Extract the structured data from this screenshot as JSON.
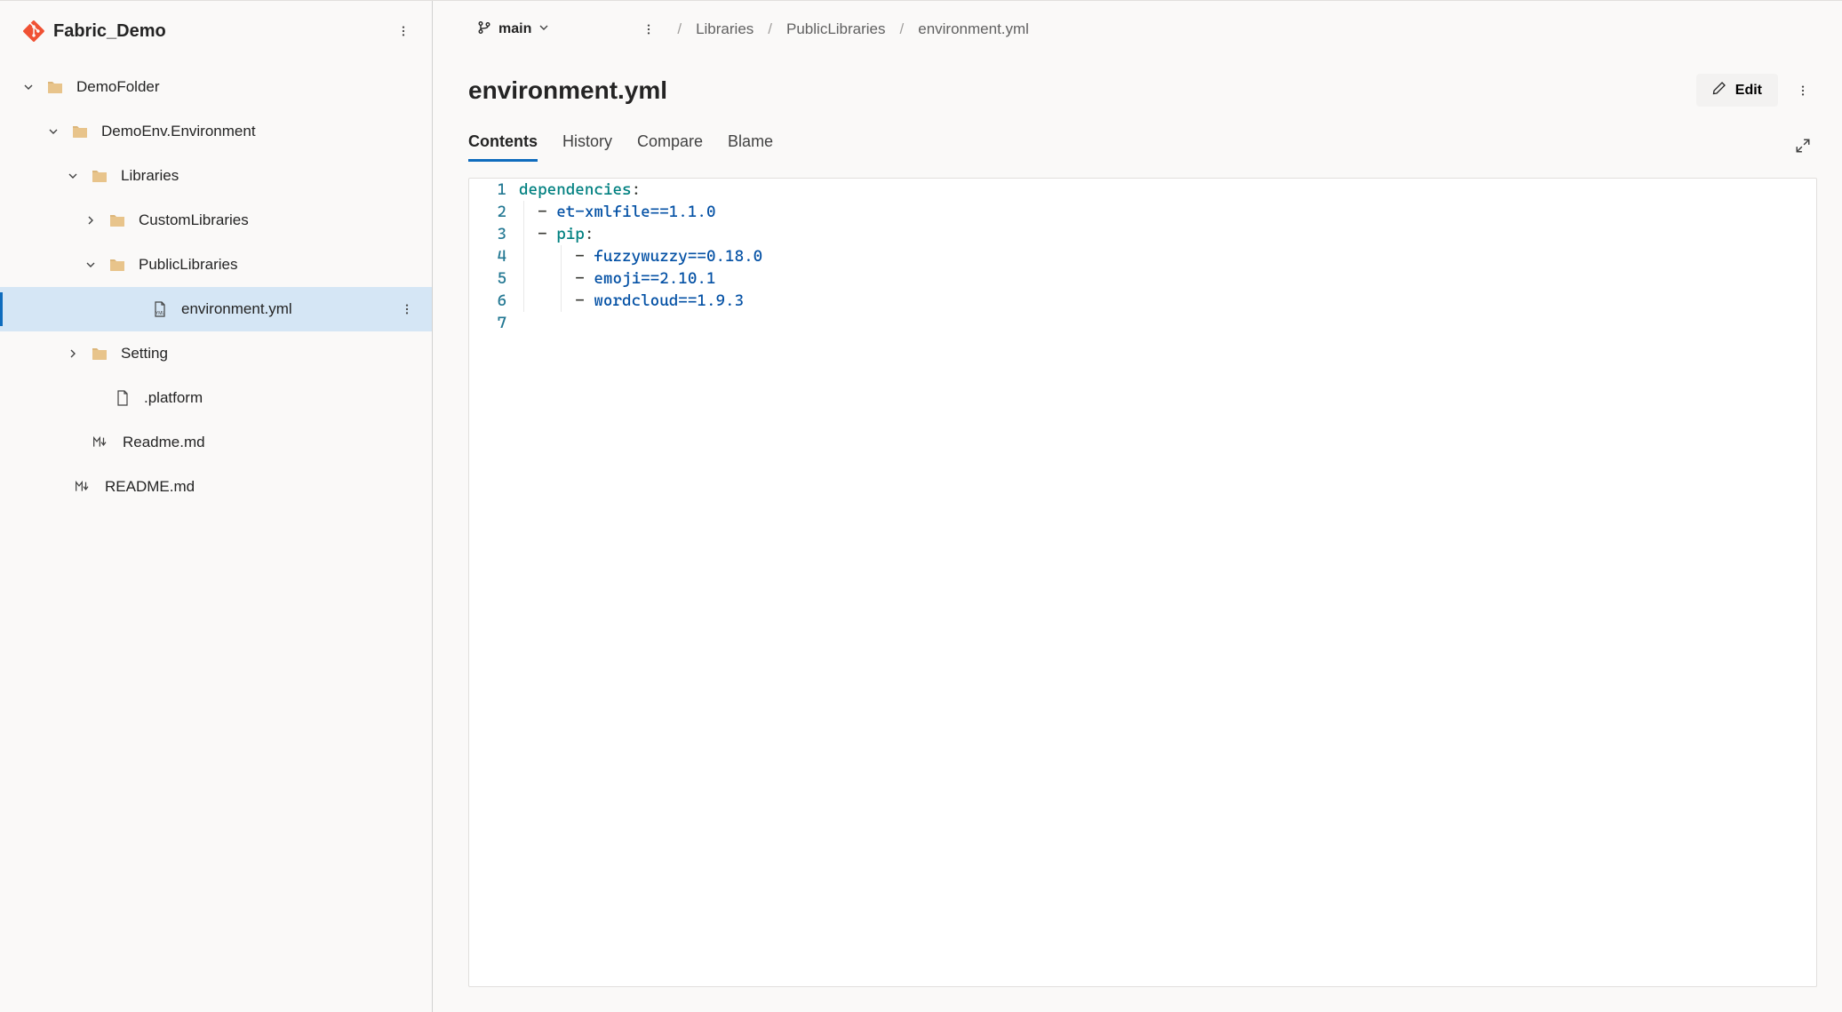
{
  "repo": {
    "name": "Fabric_Demo"
  },
  "tree": {
    "items": [
      {
        "indent": 24,
        "chevron": "down",
        "icon": "folder",
        "label": "DemoFolder"
      },
      {
        "indent": 52,
        "chevron": "down",
        "icon": "folder",
        "label": "DemoEnv.Environment"
      },
      {
        "indent": 74,
        "chevron": "down",
        "icon": "folder",
        "label": "Libraries"
      },
      {
        "indent": 94,
        "chevron": "right",
        "icon": "folder",
        "label": "CustomLibraries"
      },
      {
        "indent": 94,
        "chevron": "down",
        "icon": "folder",
        "label": "PublicLibraries"
      },
      {
        "indent": 142,
        "chevron": "none",
        "icon": "yml",
        "label": "environment.yml",
        "selected": true,
        "more": true
      },
      {
        "indent": 74,
        "chevron": "right",
        "icon": "folder",
        "label": "Setting"
      },
      {
        "indent": 100,
        "chevron": "none",
        "icon": "file",
        "label": ".platform"
      },
      {
        "indent": 76,
        "chevron": "none",
        "icon": "md",
        "label": "Readme.md"
      },
      {
        "indent": 56,
        "chevron": "none",
        "icon": "md",
        "label": "README.md"
      }
    ]
  },
  "branch": {
    "name": "main"
  },
  "breadcrumb": {
    "items": [
      {
        "label": "Libraries"
      },
      {
        "label": "PublicLibraries"
      },
      {
        "label": "environment.yml"
      }
    ]
  },
  "file": {
    "title": "environment.yml"
  },
  "buttons": {
    "edit": "Edit"
  },
  "tabs": {
    "items": [
      {
        "label": "Contents",
        "active": true
      },
      {
        "label": "History"
      },
      {
        "label": "Compare"
      },
      {
        "label": "Blame"
      }
    ]
  },
  "code": {
    "lines": [
      {
        "n": 1,
        "html": "<span class='tok-key'>dependencies</span><span class='tok-punct'>:</span>"
      },
      {
        "n": 2,
        "html": "  <span class='tok-punct'>-</span> <span class='tok-str'>et-xmlfile==1.1.0</span>"
      },
      {
        "n": 3,
        "html": "  <span class='tok-punct'>-</span> <span class='tok-key'>pip</span><span class='tok-punct'>:</span>"
      },
      {
        "n": 4,
        "html": "      <span class='tok-punct'>-</span> <span class='tok-str'>fuzzywuzzy==0.18.0</span>"
      },
      {
        "n": 5,
        "html": "      <span class='tok-punct'>-</span> <span class='tok-str'>emoji==2.10.1</span>"
      },
      {
        "n": 6,
        "html": "      <span class='tok-punct'>-</span> <span class='tok-str'>wordcloud==1.9.3</span>"
      },
      {
        "n": 7,
        "html": ""
      }
    ]
  }
}
